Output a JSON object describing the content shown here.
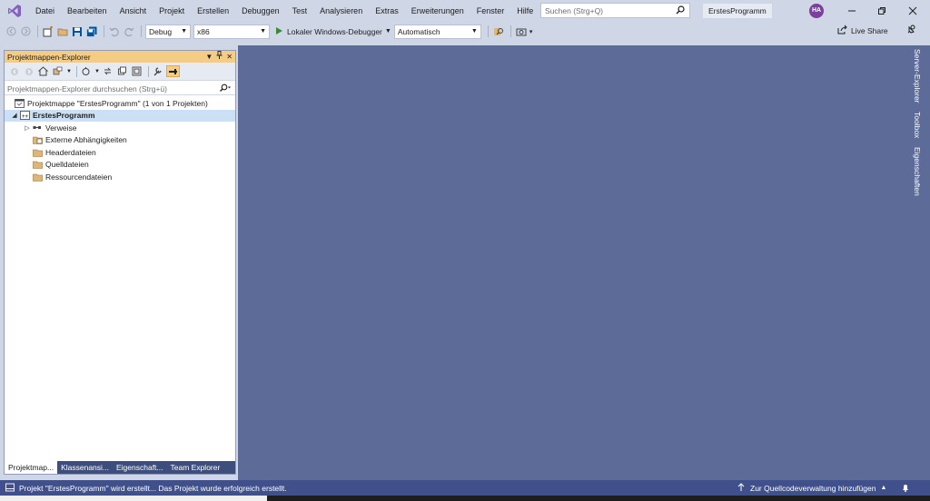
{
  "menu": [
    "Datei",
    "Bearbeiten",
    "Ansicht",
    "Projekt",
    "Erstellen",
    "Debuggen",
    "Test",
    "Analysieren",
    "Extras",
    "Erweiterungen",
    "Fenster",
    "Hilfe"
  ],
  "search": {
    "placeholder": "Suchen (Strg+Q)"
  },
  "solution_name": "ErstesProgramm",
  "user_initials": "HA",
  "toolbar": {
    "configuration": "Debug",
    "platform": "x86",
    "run_label": "Lokaler Windows-Debugger",
    "run_mode": "Automatisch",
    "live_share": "Live Share"
  },
  "explorer": {
    "title": "Projektmappen-Explorer",
    "search_placeholder": "Projektmappen-Explorer durchsuchen (Strg+ü)",
    "tree": {
      "solution": "Projektmappe \"ErstesProgramm\" (1 von 1 Projekten)",
      "project": "ErstesProgramm",
      "references": "Verweise",
      "external_deps": "Externe Abhängigkeiten",
      "headers": "Headerdateien",
      "sources": "Quelldateien",
      "resources": "Ressourcendateien"
    },
    "tabs": [
      "Projektmap...",
      "Klassenansi...",
      "Eigenschaft...",
      "Team Explorer"
    ]
  },
  "right_rail": [
    "Server-Explorer",
    "Toolbox",
    "Eigenschaften"
  ],
  "status": {
    "message": "Projekt \"ErstesProgramm\" wird erstellt... Das Projekt wurde erfolgreich erstellt.",
    "source_control": "Zur Quellcodeverwaltung hinzufügen"
  },
  "colors": {
    "chrome": "#cfd6e5",
    "editor_bg": "#5d6b99",
    "statusbar": "#40508d",
    "panel_header": "#f5cc84",
    "vs_purple": "#865fc5"
  }
}
